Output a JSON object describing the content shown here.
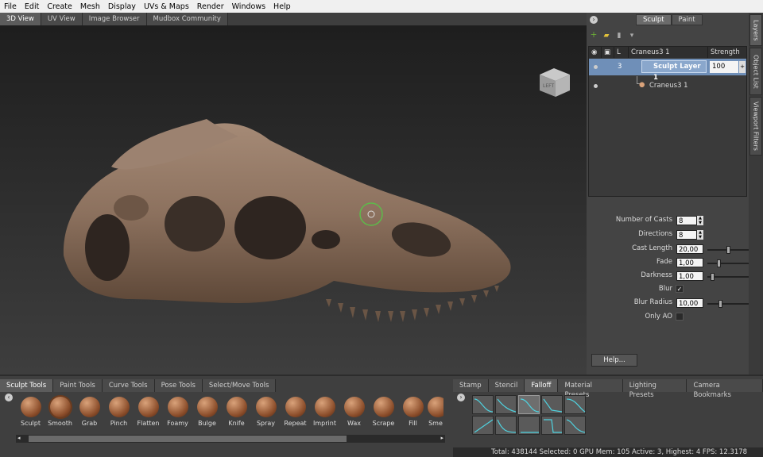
{
  "menu": [
    "File",
    "Edit",
    "Create",
    "Mesh",
    "Display",
    "UVs & Maps",
    "Render",
    "Windows",
    "Help"
  ],
  "viewport_tabs": [
    "3D View",
    "UV View",
    "Image Browser",
    "Mudbox Community"
  ],
  "cube_label": "LEFT",
  "panel": {
    "sculpt_tab": "Sculpt",
    "paint_tab": "Paint",
    "side_tabs": [
      "Layers",
      "Object List",
      "Viewport Filters"
    ],
    "header": {
      "vis": "",
      "lock": "",
      "L": "L",
      "name": "Craneus3 1",
      "strength": "Strength"
    },
    "layer1": {
      "index": "3",
      "name": "Sculpt Layer 1",
      "strength": "100"
    },
    "layer2": {
      "name": "Craneus3 1"
    }
  },
  "props": {
    "num_casts": {
      "label": "Number of Casts",
      "value": "8"
    },
    "directions": {
      "label": "Directions",
      "value": "8"
    },
    "cast_length": {
      "label": "Cast Length",
      "value": "20,00"
    },
    "fade": {
      "label": "Fade",
      "value": "1,00"
    },
    "darkness": {
      "label": "Darkness",
      "value": "1,00"
    },
    "blur": {
      "label": "Blur",
      "checked": "✓"
    },
    "blur_radius": {
      "label": "Blur Radius",
      "value": "10,00"
    },
    "only_ao": {
      "label": "Only AO",
      "checked": ""
    },
    "help": "Help..."
  },
  "tool_tabs": [
    "Sculpt Tools",
    "Paint Tools",
    "Curve Tools",
    "Pose Tools",
    "Select/Move Tools"
  ],
  "tray_tabs": [
    "Stamp",
    "Stencil",
    "Falloff",
    "Material Presets",
    "Lighting Presets",
    "Camera Bookmarks"
  ],
  "tools": [
    "Sculpt",
    "Smooth",
    "Grab",
    "Pinch",
    "Flatten",
    "Foamy",
    "Bulge",
    "Knife",
    "Spray",
    "Repeat",
    "Imprint",
    "Wax",
    "Scrape",
    "Fill",
    "Sme"
  ],
  "status": "Total: 438144  Selected: 0 GPU Mem: 105  Active: 3, Highest: 4  FPS: 12.3178",
  "colors": {
    "selection": "#6f8fb8",
    "skull": "#8c6f5a",
    "cursor_ring": "#5dbb4a"
  }
}
